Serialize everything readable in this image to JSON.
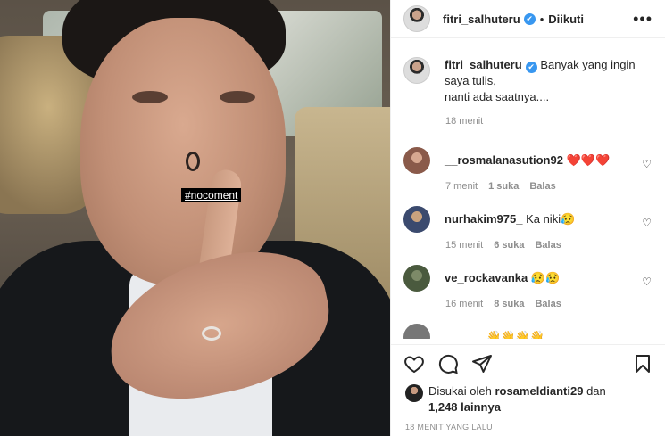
{
  "photo": {
    "hashtag": "#nocoment"
  },
  "header": {
    "username": "fitri_salhuteru",
    "verified_mark": "✔",
    "separator": "•",
    "follow_status": "Diikuti",
    "more_icon": "more-dots-icon"
  },
  "caption": {
    "username": "fitri_salhuteru",
    "lines": [
      "Banyak yang ingin",
      "saya tulis,",
      "nanti ada saatnya...."
    ],
    "time": "18 menit"
  },
  "comments": [
    {
      "username": "__rosmalanasution92",
      "text": "❤️❤️❤️",
      "time": "7 menit",
      "likes": "1 suka",
      "reply": "Balas",
      "avatar_color": "#8a5a4a"
    },
    {
      "username": "nurhakim975_",
      "text": "Ka niki😥",
      "time": "15 menit",
      "likes": "6 suka",
      "reply": "Balas",
      "avatar_color": "#3b4a6e"
    },
    {
      "username": "ve_rockavanka",
      "text": "😥😥",
      "time": "16 menit",
      "likes": "8 suka",
      "reply": "Balas",
      "avatar_color": "#5d6d4f"
    },
    {
      "username": "______",
      "text": "👋👋👋👋",
      "time": "",
      "likes": "",
      "reply": "",
      "avatar_color": "#777777"
    }
  ],
  "actions": {
    "like_icon": "heart-icon",
    "comment_icon": "comment-icon",
    "share_icon": "share-icon",
    "save_icon": "bookmark-icon"
  },
  "likes": {
    "prefix": "Disukai oleh",
    "user": "rosameldianti29",
    "conj": "dan",
    "count": "1,248 lainnya"
  },
  "timestamp": "18 MENIT YANG LALU",
  "colors": {
    "verified": "#3897f0",
    "muted": "#8e8e8e",
    "text": "#262626",
    "heart": "#e0245e"
  }
}
